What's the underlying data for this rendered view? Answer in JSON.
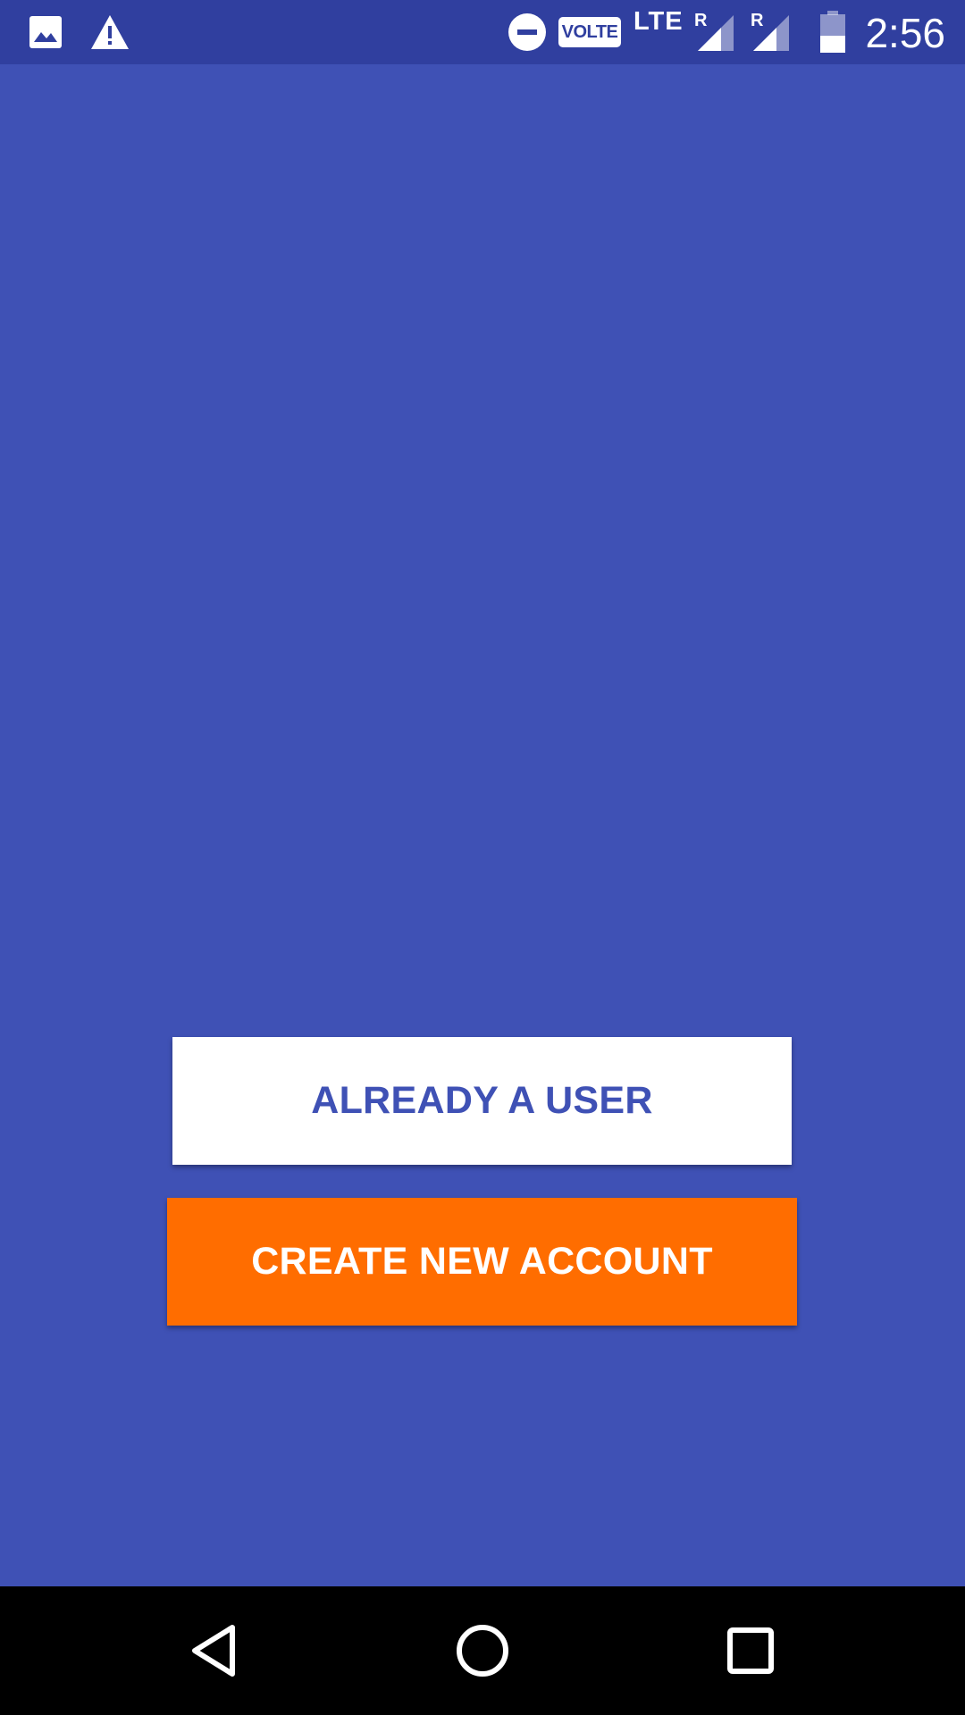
{
  "status_bar": {
    "time": "2:56",
    "network_type": "LTE",
    "volte_label": "VOLTE",
    "roaming_label": "R",
    "icons": [
      "image-icon",
      "warning-icon",
      "do-not-disturb-icon",
      "volte-icon",
      "signal-roaming-icon",
      "signal-roaming-icon",
      "battery-icon"
    ]
  },
  "main": {
    "login_button_label": "ALREADY A USER",
    "create_account_button_label": "CREATE NEW ACCOUNT"
  },
  "nav_bar": {
    "buttons": [
      "back-icon",
      "home-icon",
      "recents-icon"
    ]
  },
  "colors": {
    "primary": "#3F51B5",
    "primary_dark": "#303F9F",
    "accent": "#FF6D00",
    "white": "#FFFFFF",
    "nav_background": "#000000"
  }
}
